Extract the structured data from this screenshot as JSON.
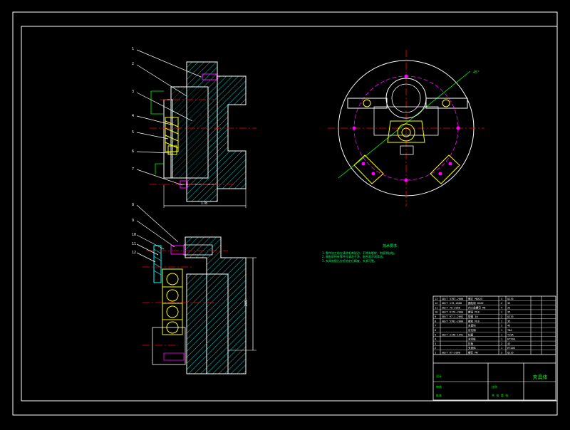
{
  "drawing": {
    "balloons_upper": [
      "1",
      "2",
      "3",
      "4",
      "5",
      "6",
      "7"
    ],
    "balloons_lower": [
      "8",
      "9",
      "10",
      "11",
      "12"
    ],
    "dim_upper_width": "178",
    "dim_lower_height": "205",
    "plan_angle_label": "45°"
  },
  "notes": {
    "title": "技术要求",
    "lines": [
      "1.零件加工前应清除毛刺锐边，不得有裂纹、划痕等缺陷。",
      "2.装配前所有零件应清洗干净，配合面涂润滑油。",
      "3.夹具装配后应检验定位精度，夹紧可靠。"
    ]
  },
  "bom": {
    "rows": [
      {
        "no": "13",
        "code": "GB/T 5783-2000",
        "name": "螺钉 M8X25",
        "qty": "4",
        "mat": "Q235"
      },
      {
        "no": "12",
        "code": "GB/T 119-2000",
        "name": "圆柱销 6X20",
        "qty": "2",
        "mat": "35"
      },
      {
        "no": "11",
        "code": "GB/T 70-2000",
        "name": "内六角螺钉 M8",
        "qty": "4",
        "mat": "35"
      },
      {
        "no": "10",
        "code": "GB/T 6170-2000",
        "name": "螺母 M10",
        "qty": "2",
        "mat": "35"
      },
      {
        "no": "9",
        "code": "GB/T 97.1-2002",
        "name": "垫圈 10",
        "qty": "2",
        "mat": "Q235"
      },
      {
        "no": "8",
        "code": "GB/T 5782-2000",
        "name": "螺栓 M10",
        "qty": "2",
        "mat": "35"
      },
      {
        "no": "7",
        "code": "",
        "name": "夹紧块",
        "qty": "2",
        "mat": "45"
      },
      {
        "no": "6",
        "code": "",
        "name": "定位销",
        "qty": "1",
        "mat": "T8A"
      },
      {
        "no": "5",
        "code": "GB/T 2148-1991",
        "name": "钻套",
        "qty": "1",
        "mat": "T10A"
      },
      {
        "no": "4",
        "code": "",
        "name": "支承板",
        "qty": "1",
        "mat": "HT200"
      },
      {
        "no": "3",
        "code": "",
        "name": "压板",
        "qty": "2",
        "mat": "45"
      },
      {
        "no": "2",
        "code": "",
        "name": "夹具体",
        "qty": "1",
        "mat": "HT200"
      },
      {
        "no": "1",
        "code": "GB/T 67-2000",
        "name": "螺钉 M6",
        "qty": "3",
        "mat": "Q235"
      }
    ],
    "title_block": {
      "title": "夹具体",
      "scale_label": "比例",
      "sheet_label": "共 张 第 张",
      "designer": "设计",
      "checker": "审核",
      "approver": "批准"
    }
  },
  "colors": {
    "background": "#000000",
    "frame": "#ffffff",
    "outline": "#ffffff",
    "hatch": "#00ffff",
    "center": "#ff0000",
    "part": "#ffff00",
    "annotation": "#00ff00",
    "magenta": "#ff00ff"
  }
}
